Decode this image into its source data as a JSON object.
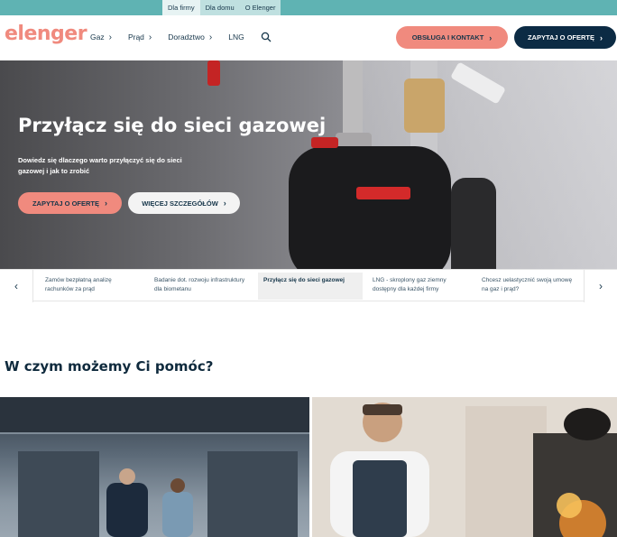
{
  "topbar": {
    "tabs": [
      {
        "label": "Dla firmy",
        "active": true
      },
      {
        "label": "Dla domu",
        "active": false
      },
      {
        "label": "O Elenger",
        "active": false
      }
    ]
  },
  "header": {
    "logo": "elenger",
    "nav": [
      {
        "label": "Gaz",
        "has_chevron": true
      },
      {
        "label": "Prąd",
        "has_chevron": true
      },
      {
        "label": "Doradztwo",
        "has_chevron": true
      },
      {
        "label": "LNG",
        "has_chevron": false
      }
    ],
    "search_icon": "search-icon",
    "contact_button": "OBSŁUGA I KONTAKT",
    "offer_button": "ZAPYTAJ O OFERTĘ",
    "colors": {
      "accent": "#f08a7e",
      "dark": "#0c2b44",
      "teal": "#5fb3b3"
    }
  },
  "hero": {
    "title": "Przyłącz się do sieci gazowej",
    "subtitle": "Dowiedz się dlaczego warto przyłączyć się do sieci gazowej i jak to zrobić",
    "primary_button": "ZAPYTAJ O OFERTĘ",
    "secondary_button": "WIĘCEJ SZCZEGÓŁÓW"
  },
  "slider": {
    "items": [
      {
        "label": "Zamów bezpłatną analizę rachunków za prąd",
        "active": false
      },
      {
        "label": "Badanie dot. rozwoju infrastruktury dla biometanu",
        "active": false
      },
      {
        "label": "Przyłącz się do sieci gazowej",
        "active": true
      },
      {
        "label": "LNG - skroplony gaz ziemny dostępny dla każdej firmy",
        "active": false
      },
      {
        "label": "Chcesz uelastycznić swoją umowę na gaz i prąd?",
        "active": false
      }
    ]
  },
  "section": {
    "title": "W czym możemy Ci pomóc?"
  }
}
